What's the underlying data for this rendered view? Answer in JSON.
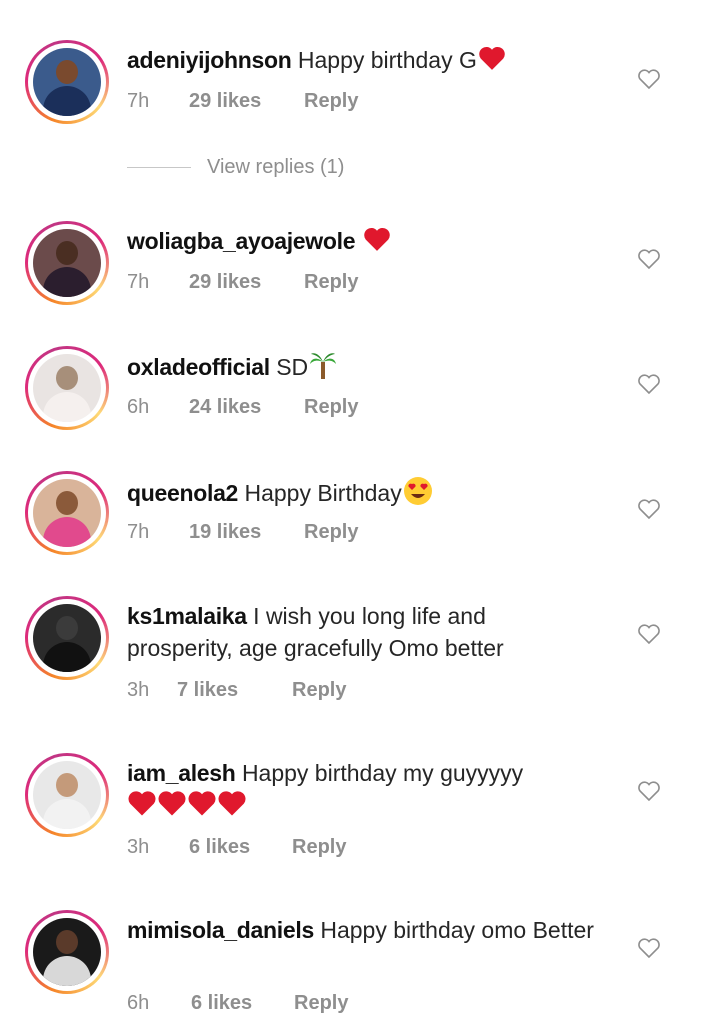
{
  "comments": [
    {
      "username": "adeniyijohnson",
      "text": "Happy birthday G",
      "emoji": "red-heart",
      "time": "7h",
      "likes": "29 likes",
      "reply": "Reply",
      "avatar_colors": [
        "#3b5b8c",
        "#1b2f5a"
      ]
    },
    {
      "username": "woliagba_ayoajewole",
      "text": "",
      "emoji": "red-heart",
      "time": "7h",
      "likes": "29 likes",
      "reply": "Reply",
      "avatar_colors": [
        "#6b4b4b",
        "#2b1e2e"
      ]
    },
    {
      "username": "oxladeofficial",
      "text": "SD",
      "emoji": "palm-tree",
      "time": "6h",
      "likes": "24 likes",
      "reply": "Reply",
      "avatar_colors": [
        "#a78f7a",
        "#e9e4e2"
      ]
    },
    {
      "username": "queenola2",
      "text": "Happy Birthday",
      "emoji": "heart-eyes",
      "time": "7h",
      "likes": "19 likes",
      "reply": "Reply",
      "avatar_colors": [
        "#8b5a3a",
        "#e14a8d"
      ]
    },
    {
      "username": "ks1malaika",
      "text": "I wish you long life and prosperity, age gracefully Omo better",
      "emoji": "",
      "time": "3h",
      "likes": "7 likes",
      "reply": "Reply",
      "avatar_colors": [
        "#3b3b3b",
        "#111111"
      ]
    },
    {
      "username": "iam_alesh",
      "text": "Happy birthday my guyyyyy",
      "emoji": "four-red-hearts",
      "time": "3h",
      "likes": "6 likes",
      "reply": "Reply",
      "avatar_colors": [
        "#c49a7a",
        "#f2f2f2"
      ]
    },
    {
      "username": "mimisola_daniels",
      "text": "Happy birthday omo Better",
      "emoji": "",
      "time": "6h",
      "likes": "6 likes",
      "reply": "Reply",
      "avatar_colors": [
        "#5a3a2a",
        "#1a1a1a"
      ]
    }
  ],
  "view_replies": {
    "label": "View replies (1)"
  },
  "colors": {
    "meta": "#8e8e8e",
    "text": "#262626",
    "heart": "#e0182d"
  }
}
